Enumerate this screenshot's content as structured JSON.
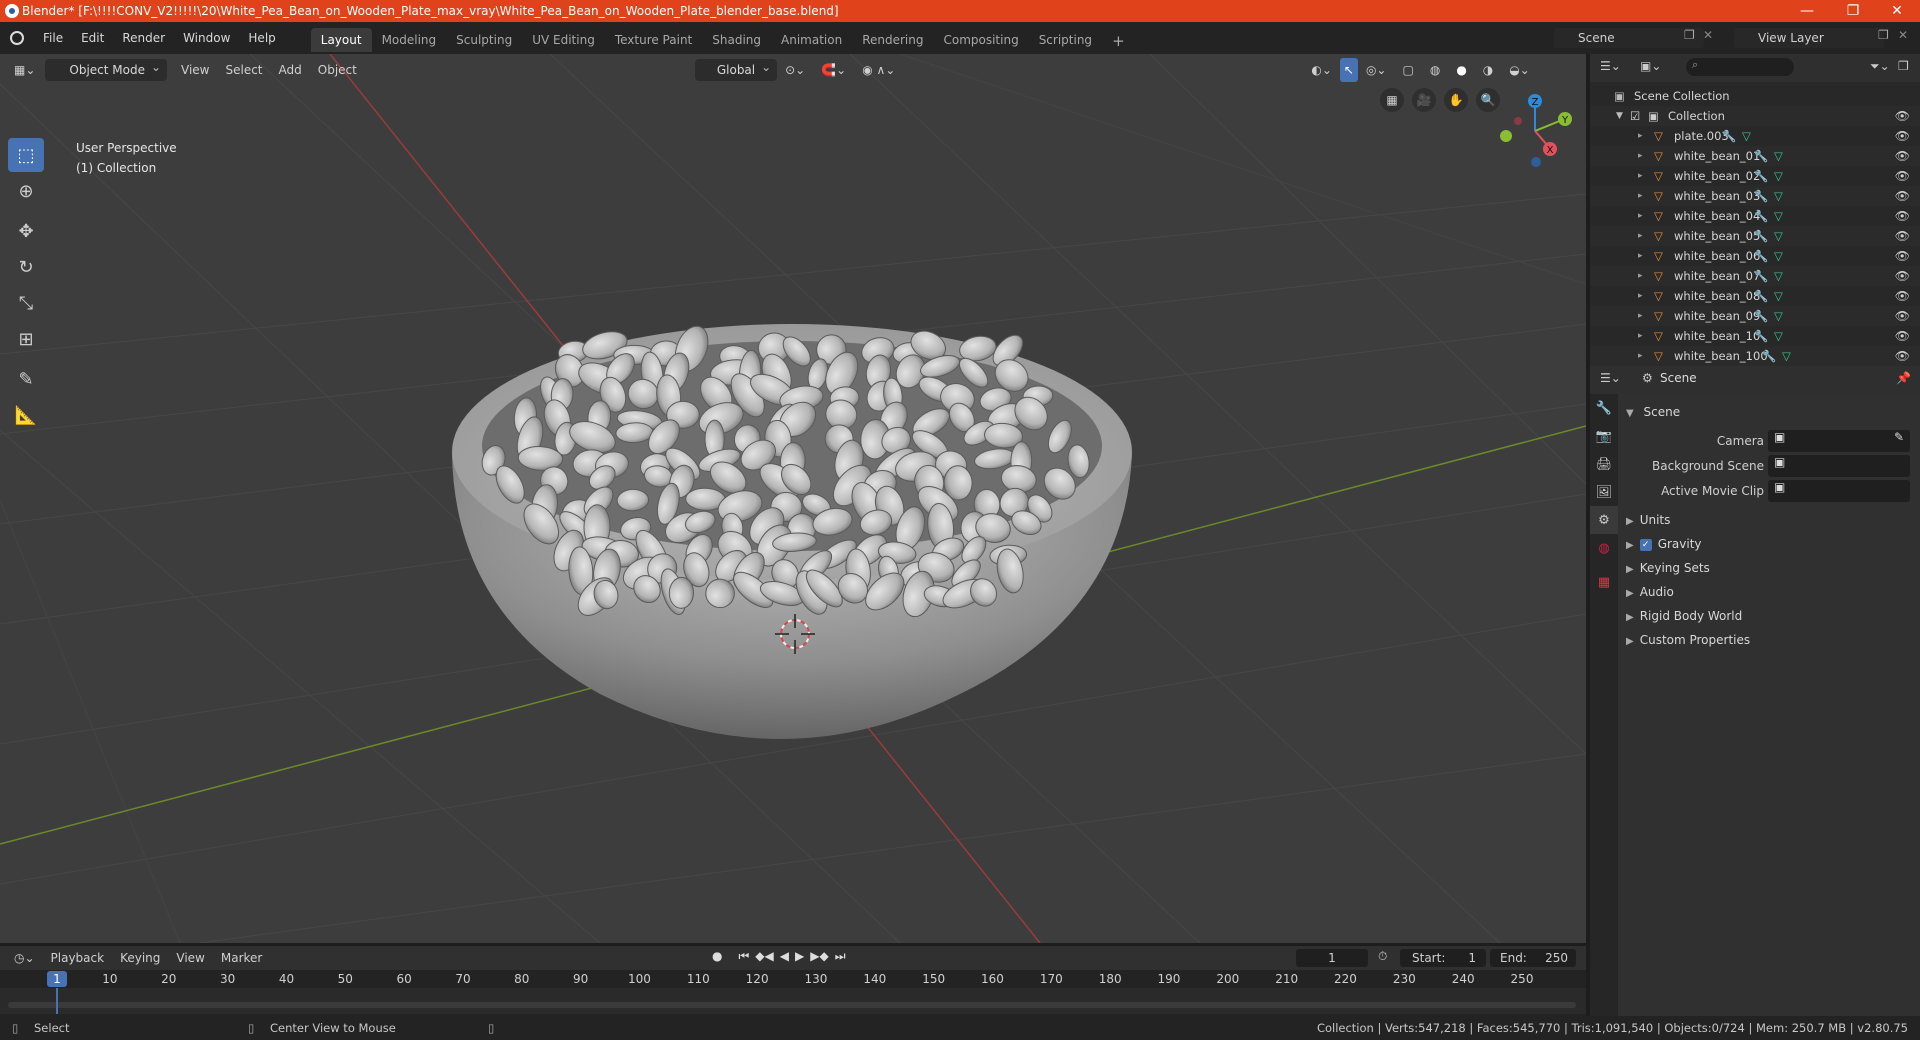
{
  "window": {
    "title": "Blender* [F:\\!!!!CONV_V2!!!!!\\20\\White_Pea_Bean_on_Wooden_Plate_max_vray\\White_Pea_Bean_on_Wooden_Plate_blender_base.blend]",
    "minimize": "—",
    "restore": "❐",
    "close": "✕"
  },
  "menubar": {
    "items": [
      "File",
      "Edit",
      "Render",
      "Window",
      "Help"
    ],
    "workspaces": [
      "Layout",
      "Modeling",
      "Sculpting",
      "UV Editing",
      "Texture Paint",
      "Shading",
      "Animation",
      "Rendering",
      "Compositing",
      "Scripting"
    ],
    "active_workspace": "Layout",
    "add_workspace": "+",
    "scene_label": "Scene",
    "view_layer_label": "View Layer"
  },
  "viewport": {
    "mode": "Object Mode",
    "menus": [
      "View",
      "Select",
      "Add",
      "Object"
    ],
    "transform_orientation": "Global",
    "info_line1": "User Perspective",
    "info_line2": "(1) Collection",
    "gizmo_axes": {
      "z": "Z",
      "y": "Y",
      "x": "X"
    }
  },
  "outliner": {
    "root": "Scene Collection",
    "collection": "Collection",
    "objects": [
      "plate.003",
      "white_bean_01",
      "white_bean_02",
      "white_bean_03",
      "white_bean_04",
      "white_bean_05",
      "white_bean_06",
      "white_bean_07",
      "white_bean_08",
      "white_bean_09",
      "white_bean_10",
      "white_bean_100"
    ]
  },
  "properties": {
    "context": "Scene",
    "panel": "Scene",
    "fields": [
      {
        "label": "Camera"
      },
      {
        "label": "Background Scene"
      },
      {
        "label": "Active Movie Clip"
      }
    ],
    "subpanels": [
      "Units",
      "Gravity",
      "Keying Sets",
      "Audio",
      "Rigid Body World",
      "Custom Properties"
    ],
    "gravity_checked": true
  },
  "timeline": {
    "menus": [
      "Playback",
      "Keying",
      "View",
      "Marker"
    ],
    "current_frame": "1",
    "start_label": "Start:",
    "start_value": "1",
    "end_label": "End:",
    "end_value": "250",
    "ticks": [
      "1",
      "10",
      "20",
      "30",
      "40",
      "50",
      "60",
      "70",
      "80",
      "90",
      "100",
      "110",
      "120",
      "130",
      "140",
      "150",
      "160",
      "170",
      "180",
      "190",
      "200",
      "210",
      "220",
      "230",
      "240",
      "250"
    ]
  },
  "statusbar": {
    "left_action": "Select",
    "mid_action": "Center View to Mouse",
    "stats": "Collection | Verts:547,218 | Faces:545,770 | Tris:1,091,540 | Objects:0/724 | Mem: 250.7 MB | v2.80.75"
  },
  "colors": {
    "title_bar": "#e0431c",
    "active_tool": "#4772b3",
    "object_icon": "#e38d3c",
    "mesh_icon": "#3ec28f",
    "modifier_icon": "#5b8ed8",
    "x_axis": "#e2505c",
    "y_axis": "#8bbd33",
    "z_axis": "#2f8bd9"
  }
}
